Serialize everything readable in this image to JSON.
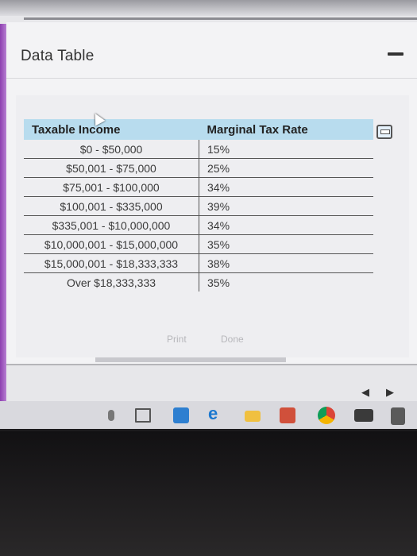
{
  "dialog": {
    "title": "Data Table",
    "print_label": "Print",
    "done_label": "Done"
  },
  "table": {
    "headers": [
      "Taxable Income",
      "Marginal Tax Rate"
    ],
    "rows": [
      {
        "income": "$0 - $50,000",
        "rate": "15%"
      },
      {
        "income": "$50,001 - $75,000",
        "rate": "25%"
      },
      {
        "income": "$75,001 - $100,000",
        "rate": "34%"
      },
      {
        "income": "$100,001 - $335,000",
        "rate": "39%"
      },
      {
        "income": "$335,001 - $10,000,000",
        "rate": "34%"
      },
      {
        "income": "$10,000,001 - $15,000,000",
        "rate": "35%"
      },
      {
        "income": "$15,000,001 - $18,333,333",
        "rate": "38%"
      },
      {
        "income": "Over $18,333,333",
        "rate": "35%"
      }
    ]
  },
  "nav": {
    "prev_label": "◀",
    "next_label": "▶"
  },
  "colors": {
    "header_bg": "#b8dcee",
    "accent_strip": "#8d3fb0"
  },
  "icons": [
    "minimize-icon",
    "expand-icon",
    "mic-icon",
    "task-view-icon",
    "store-icon",
    "edge-icon",
    "file-explorer-icon",
    "calendar-icon",
    "chrome-icon",
    "mail-icon",
    "calculator-icon"
  ]
}
